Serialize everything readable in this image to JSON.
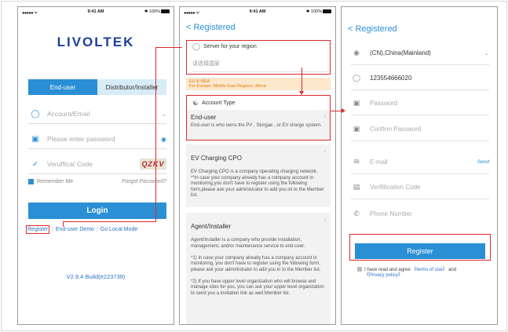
{
  "status_bar": {
    "signal": "●●●●● ᯤ",
    "time": "9:41 AM",
    "battery": "✱ 100%"
  },
  "login": {
    "logo": "LIVOLTEK",
    "tabs": [
      "End-user",
      "Distributor/Installer"
    ],
    "account_placeholder": "Account/Email",
    "password_placeholder": "Please enter password",
    "code_placeholder": "Verufficat Code",
    "captcha": "QZKV",
    "remember": "Remember Me",
    "forgot": "Forgot Password?",
    "login_button": "Login",
    "register_link": "Register",
    "demo_link": "End-user Demo",
    "local_link": "Go Local Mode",
    "version": "V2.9.4 Build(e223739)"
  },
  "register_type": {
    "back": "< Registered",
    "server_title": "Server for your region",
    "server_placeholder": "请选择国家",
    "server_note_1": "EU & MEA",
    "server_note_2": "For Europe, Middle East Regions, Africa",
    "account_type": "Account Type",
    "cards": [
      {
        "title": "End-user",
        "body": "End-user is who owns the PV , Storgae , or EV charge system."
      },
      {
        "title": "EV Charging CPO",
        "body": "EV Charging CPO is a company operating charging network.\n**In case your company already has a company account in monitoring,you don't have to register using the following form,please ask your administrator to add you ini to the Member list."
      },
      {
        "title": "Agent/Installer",
        "body": "Agent/Installer is a company who provide installation, management, and/or maintenance service to end-user.\n\n*1) In case your company already has a company account in monitoring, you don't have to register using the following form, please ask your administrator to add you in to the Member list.\n\n*2) If you have upper level organization who will browse and manage sites for you, you can ask your upper level organization to send you a invitation link as well.Member list."
      }
    ]
  },
  "register_form": {
    "back": "< Registered",
    "region": "(CN),China(Mainland)",
    "account": "123554666020",
    "password": "Password",
    "confirm": "Confirm Password",
    "email": "E-mail",
    "send": "Send",
    "verification": "Verifitication Code",
    "phone": "Phone Number",
    "button": "Register",
    "agree_text": "I have read and agree",
    "terms": "《terms of use》",
    "and": "and",
    "privacy": "《Privacy policy》"
  },
  "colors": {
    "accent": "#2a8fd4",
    "brand": "#1e3f97",
    "highlight": "#e0282c",
    "note": "#e07c12"
  }
}
